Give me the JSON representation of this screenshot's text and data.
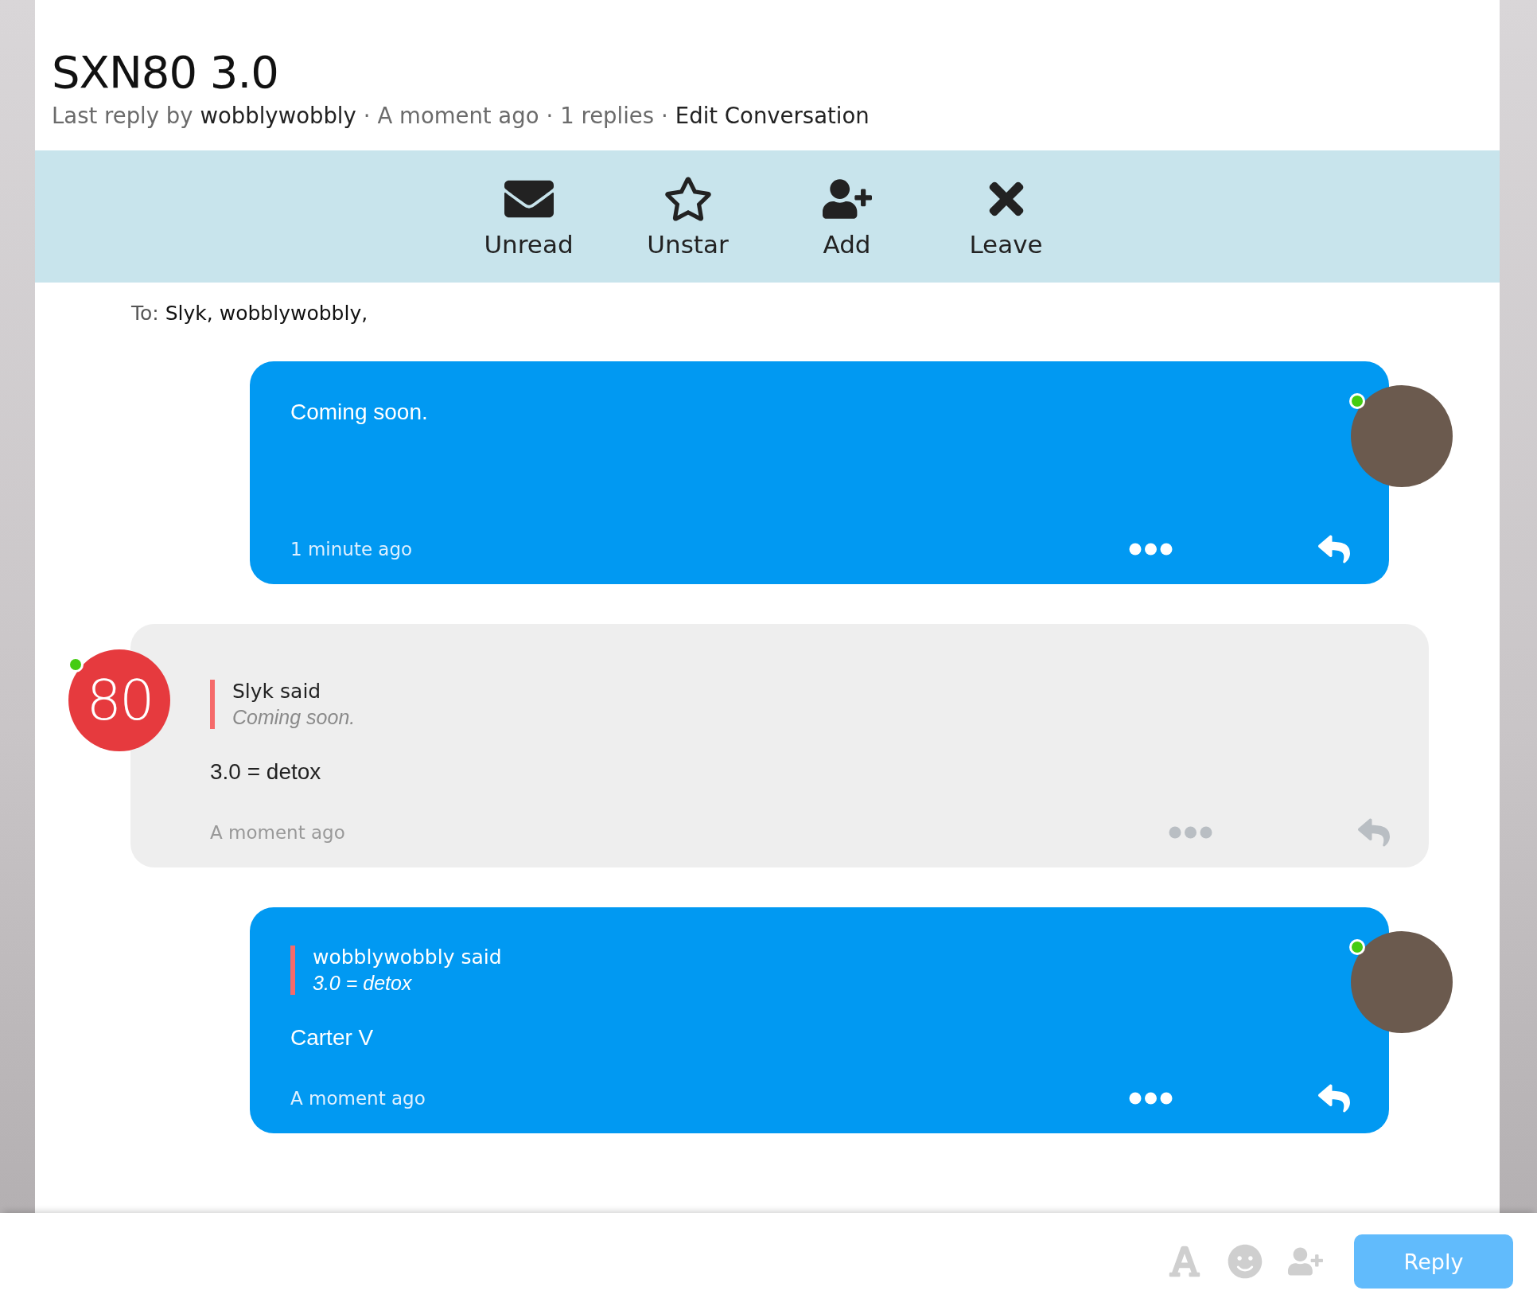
{
  "title": "SXN80 3.0",
  "meta": [
    {
      "text": "Last reply by",
      "kind": "plain"
    },
    {
      "text": "wobblywobbly",
      "kind": "user"
    },
    {
      "text": "·",
      "kind": "separator"
    },
    {
      "text": "A moment ago",
      "kind": "plain"
    },
    {
      "text": "·",
      "kind": "separator"
    },
    {
      "text": "1 replies",
      "kind": "plain"
    },
    {
      "text": "·",
      "kind": "separator"
    },
    {
      "text": "Edit Conversation",
      "kind": "link"
    }
  ],
  "toolbar": [
    {
      "label": "Unread"
    },
    {
      "label": "Unstar"
    },
    {
      "label": "Add"
    },
    {
      "label": "Leave"
    }
  ],
  "recipients": {
    "label": "To:",
    "names": "Slyk, wobblywobbly,"
  },
  "messages": [
    {
      "kind": "own",
      "online": true,
      "body": "Coming soon.",
      "time": "1 minute ago"
    },
    {
      "kind": "other",
      "badge": "80",
      "online": true,
      "quote": {
        "author": "Slyk said",
        "text": "Coming soon."
      },
      "body": "3.0 = detox",
      "time": "A moment ago"
    },
    {
      "kind": "own",
      "online": true,
      "quote": {
        "author": "wobblywobbly said",
        "text": "3.0 = detox"
      },
      "body": "Carter V",
      "time": "A moment ago"
    }
  ],
  "composer": {
    "button": "Reply"
  }
}
